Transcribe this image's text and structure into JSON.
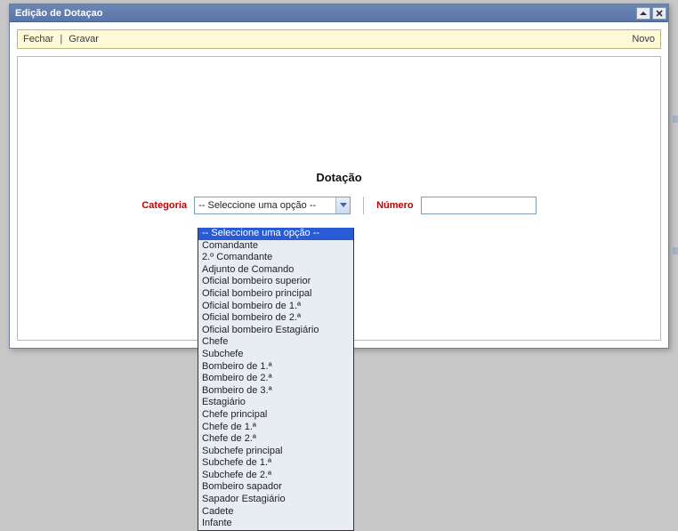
{
  "window": {
    "title": "Edição de Dotaçao"
  },
  "toolbar": {
    "close": "Fechar",
    "save": "Gravar",
    "sep": "|",
    "newLabel": "Novo"
  },
  "form": {
    "heading": "Dotação",
    "categoriaLabel": "Categoria",
    "numeroLabel": "Número",
    "numeroValue": "",
    "select": {
      "displayed": "-- Seleccione uma opção --",
      "options": [
        "-- Seleccione uma opção --",
        "Comandante",
        "2.º Comandante",
        "Adjunto de Comando",
        "Oficial bombeiro superior",
        "Oficial bombeiro principal",
        "Oficial bombeiro de 1.ª",
        "Oficial bombeiro de 2.ª",
        "Oficial bombeiro Estagiário",
        "Chefe",
        "Subchefe",
        "Bombeiro de 1.ª",
        "Bombeiro de 2.ª",
        "Bombeiro de 3.ª",
        "Estagiário",
        "Chefe principal",
        "Chefe de 1.ª",
        "Chefe de 2.ª",
        "Subchefe principal",
        "Subchefe de 1.ª",
        "Subchefe de 2.ª",
        "Bombeiro sapador",
        "Sapador Estagiário",
        "Cadete",
        "Infante"
      ],
      "selectedIndex": 0
    }
  }
}
